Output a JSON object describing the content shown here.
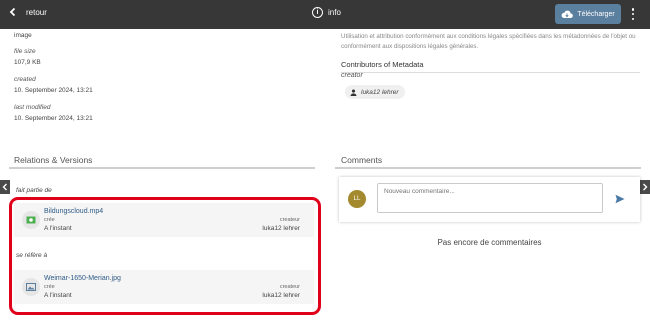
{
  "topbar": {
    "back_label": "retour",
    "info_label": "info",
    "download_label": "Télécharger"
  },
  "metadata": {
    "type_value": "image",
    "file_size_label": "file size",
    "file_size_value": "107,9 KB",
    "created_label": "created",
    "created_value": "10. September 2024, 13:21",
    "modified_label": "last modified",
    "modified_value": "10. September 2024, 13:21"
  },
  "license_text": "Utilisation et attribution conformément aux conditions légales spécifiées dans les métadonnées de l'objet ou conformément aux dispositions légales générales.",
  "contributors": {
    "title": "Contributors of Metadata",
    "creator_label": "creator",
    "creator_name": "luka12 lehrer"
  },
  "relations": {
    "title": "Relations & Versions",
    "part_of_label": "fait partie de",
    "refers_to_label": "se réfère à",
    "items": [
      {
        "name": "Bildungscloud.mp4",
        "created_label": "crée",
        "created_value": "A l'instant",
        "creator_label": "createur",
        "creator_value": "luka12 lehrer"
      },
      {
        "name": "Weimar-1650-Merian.jpg",
        "created_label": "crée",
        "created_value": "A l'instant",
        "creator_label": "createur",
        "creator_value": "luka12 lehrer"
      }
    ]
  },
  "comments": {
    "title": "Comments",
    "avatar_initials": "LL",
    "input_placeholder": "Nouveau commentaire...",
    "empty_text": "Pas encore de commentaires"
  }
}
